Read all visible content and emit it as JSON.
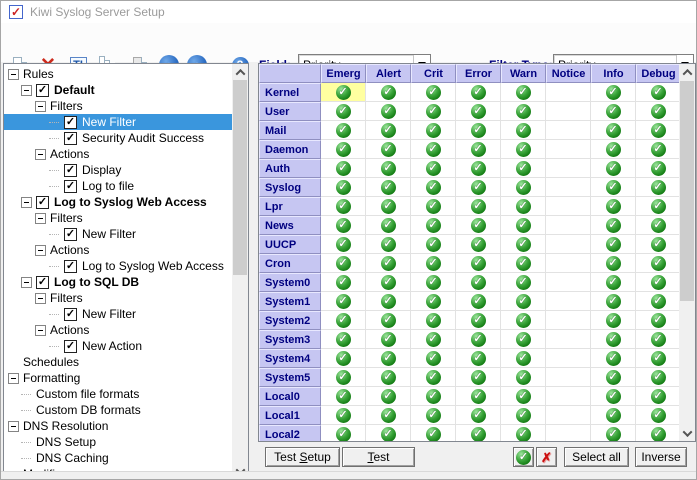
{
  "window": {
    "title": "Kiwi Syslog Server Setup"
  },
  "toolbar": {
    "icons": [
      "new-file",
      "delete",
      "rename",
      "copy",
      "paste",
      "move-up",
      "move-down",
      "help"
    ],
    "field_label": "Field:",
    "field_value": "Priority",
    "filter_type_label": "Filter Type:",
    "filter_type_value": "Priority"
  },
  "tree": {
    "items": [
      {
        "label": "Rules",
        "level": 0,
        "expander": true,
        "checkbox": false,
        "bold": false,
        "selected": false
      },
      {
        "label": "Default",
        "level": 1,
        "expander": true,
        "checkbox": true,
        "checked": true,
        "bold": true,
        "selected": false
      },
      {
        "label": "Filters",
        "level": 2,
        "expander": true,
        "checkbox": false,
        "bold": false,
        "selected": false
      },
      {
        "label": "New Filter",
        "level": 3,
        "expander": false,
        "checkbox": true,
        "checked": true,
        "bold": false,
        "selected": true
      },
      {
        "label": "Security Audit Success",
        "level": 3,
        "expander": false,
        "checkbox": true,
        "checked": true,
        "bold": false,
        "selected": false
      },
      {
        "label": "Actions",
        "level": 2,
        "expander": true,
        "checkbox": false,
        "bold": false,
        "selected": false
      },
      {
        "label": "Display",
        "level": 3,
        "expander": false,
        "checkbox": true,
        "checked": true,
        "bold": false,
        "selected": false
      },
      {
        "label": "Log to file",
        "level": 3,
        "expander": false,
        "checkbox": true,
        "checked": true,
        "bold": false,
        "selected": false
      },
      {
        "label": "Log to Syslog Web Access",
        "level": 1,
        "expander": true,
        "checkbox": true,
        "checked": true,
        "bold": true,
        "selected": false
      },
      {
        "label": "Filters",
        "level": 2,
        "expander": true,
        "checkbox": false,
        "bold": false,
        "selected": false
      },
      {
        "label": "New Filter",
        "level": 3,
        "expander": false,
        "checkbox": true,
        "checked": true,
        "bold": false,
        "selected": false
      },
      {
        "label": "Actions",
        "level": 2,
        "expander": true,
        "checkbox": false,
        "bold": false,
        "selected": false
      },
      {
        "label": "Log to Syslog Web Access",
        "level": 3,
        "expander": false,
        "checkbox": true,
        "checked": true,
        "bold": false,
        "selected": false
      },
      {
        "label": "Log to SQL DB",
        "level": 1,
        "expander": true,
        "checkbox": true,
        "checked": true,
        "bold": true,
        "selected": false
      },
      {
        "label": "Filters",
        "level": 2,
        "expander": true,
        "checkbox": false,
        "bold": false,
        "selected": false
      },
      {
        "label": "New Filter",
        "level": 3,
        "expander": false,
        "checkbox": true,
        "checked": true,
        "bold": false,
        "selected": false
      },
      {
        "label": "Actions",
        "level": 2,
        "expander": true,
        "checkbox": false,
        "bold": false,
        "selected": false
      },
      {
        "label": "New Action",
        "level": 3,
        "expander": false,
        "checkbox": true,
        "checked": true,
        "bold": false,
        "selected": false
      },
      {
        "label": "Schedules",
        "level": 0,
        "expander": false,
        "checkbox": false,
        "bold": false,
        "selected": false
      },
      {
        "label": "Formatting",
        "level": 0,
        "expander": true,
        "checkbox": false,
        "bold": false,
        "selected": false
      },
      {
        "label": "Custom file formats",
        "level": 1,
        "expander": false,
        "checkbox": false,
        "bold": false,
        "selected": false
      },
      {
        "label": "Custom DB formats",
        "level": 1,
        "expander": false,
        "checkbox": false,
        "bold": false,
        "selected": false
      },
      {
        "label": "DNS Resolution",
        "level": 0,
        "expander": true,
        "checkbox": false,
        "bold": false,
        "selected": false
      },
      {
        "label": "DNS Setup",
        "level": 1,
        "expander": false,
        "checkbox": false,
        "bold": false,
        "selected": false
      },
      {
        "label": "DNS Caching",
        "level": 1,
        "expander": false,
        "checkbox": false,
        "bold": false,
        "selected": false
      },
      {
        "label": "Modifiers",
        "level": 0,
        "expander": false,
        "checkbox": false,
        "bold": false,
        "selected": false
      }
    ]
  },
  "grid": {
    "columns": [
      "Emerg",
      "Alert",
      "Crit",
      "Error",
      "Warn",
      "Notice",
      "Info",
      "Debug"
    ],
    "rows": [
      {
        "label": "Kernel",
        "checks": [
          1,
          1,
          1,
          1,
          1,
          0,
          1,
          1
        ]
      },
      {
        "label": "User",
        "checks": [
          1,
          1,
          1,
          1,
          1,
          0,
          1,
          1
        ]
      },
      {
        "label": "Mail",
        "checks": [
          1,
          1,
          1,
          1,
          1,
          0,
          1,
          1
        ]
      },
      {
        "label": "Daemon",
        "checks": [
          1,
          1,
          1,
          1,
          1,
          0,
          1,
          1
        ]
      },
      {
        "label": "Auth",
        "checks": [
          1,
          1,
          1,
          1,
          1,
          0,
          1,
          1
        ]
      },
      {
        "label": "Syslog",
        "checks": [
          1,
          1,
          1,
          1,
          1,
          0,
          1,
          1
        ]
      },
      {
        "label": "Lpr",
        "checks": [
          1,
          1,
          1,
          1,
          1,
          0,
          1,
          1
        ]
      },
      {
        "label": "News",
        "checks": [
          1,
          1,
          1,
          1,
          1,
          0,
          1,
          1
        ]
      },
      {
        "label": "UUCP",
        "checks": [
          1,
          1,
          1,
          1,
          1,
          0,
          1,
          1
        ]
      },
      {
        "label": "Cron",
        "checks": [
          1,
          1,
          1,
          1,
          1,
          0,
          1,
          1
        ]
      },
      {
        "label": "System0",
        "checks": [
          1,
          1,
          1,
          1,
          1,
          0,
          1,
          1
        ]
      },
      {
        "label": "System1",
        "checks": [
          1,
          1,
          1,
          1,
          1,
          0,
          1,
          1
        ]
      },
      {
        "label": "System2",
        "checks": [
          1,
          1,
          1,
          1,
          1,
          0,
          1,
          1
        ]
      },
      {
        "label": "System3",
        "checks": [
          1,
          1,
          1,
          1,
          1,
          0,
          1,
          1
        ]
      },
      {
        "label": "System4",
        "checks": [
          1,
          1,
          1,
          1,
          1,
          0,
          1,
          1
        ]
      },
      {
        "label": "System5",
        "checks": [
          1,
          1,
          1,
          1,
          1,
          0,
          1,
          1
        ]
      },
      {
        "label": "Local0",
        "checks": [
          1,
          1,
          1,
          1,
          1,
          0,
          1,
          1
        ]
      },
      {
        "label": "Local1",
        "checks": [
          1,
          1,
          1,
          1,
          1,
          0,
          1,
          1
        ]
      },
      {
        "label": "Local2",
        "checks": [
          1,
          1,
          1,
          1,
          1,
          0,
          1,
          1
        ]
      }
    ],
    "highlight": {
      "row": "Kernel",
      "col": "Emerg"
    }
  },
  "buttons": {
    "test_setup": {
      "pre": "Test ",
      "underline": "S",
      "post": "etup"
    },
    "test": {
      "pre": "",
      "underline": "T",
      "post": "est"
    },
    "apply_icon": "green-check",
    "cancel_icon": "red-x",
    "select_all": "Select all",
    "inverse": "Inverse"
  },
  "colors": {
    "selection_blue": "#3a96dd",
    "grid_header_bg": "#c6c6f2",
    "header_text_navy": "#000080",
    "highlight_cell_yellow": "#ffffa0",
    "check_green": "#1e8c1e",
    "delete_red": "#cc2b1d"
  }
}
